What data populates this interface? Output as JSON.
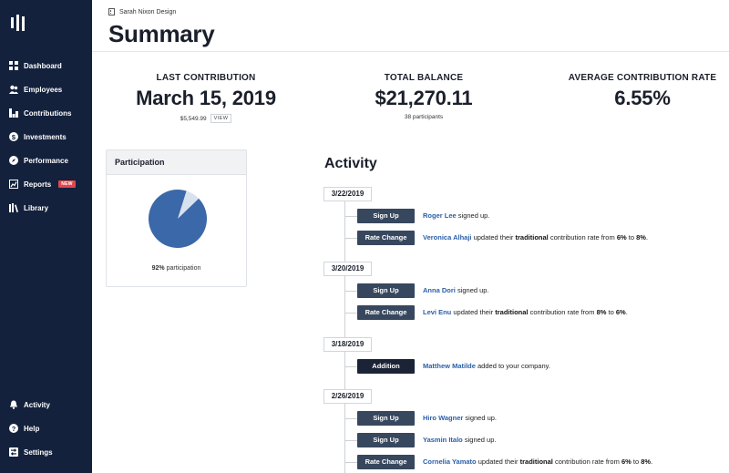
{
  "sidebar": {
    "items": [
      {
        "label": "Dashboard",
        "icon": "grid-icon"
      },
      {
        "label": "Employees",
        "icon": "users-icon"
      },
      {
        "label": "Contributions",
        "icon": "chart-icon"
      },
      {
        "label": "Investments",
        "icon": "dollar-icon"
      },
      {
        "label": "Performance",
        "icon": "compass-icon"
      },
      {
        "label": "Reports",
        "icon": "report-icon",
        "badge": "NEW"
      },
      {
        "label": "Library",
        "icon": "books-icon"
      }
    ],
    "bottom_items": [
      {
        "label": "Activity",
        "icon": "bell-icon"
      },
      {
        "label": "Help",
        "icon": "help-icon"
      },
      {
        "label": "Settings",
        "icon": "settings-icon"
      }
    ]
  },
  "header": {
    "company": "Sarah Nixon Design",
    "title": "Summary"
  },
  "stats": {
    "last_contribution": {
      "label": "LAST CONTRIBUTION",
      "value": "March 15, 2019",
      "sub": "$5,549.99",
      "action": "VIEW"
    },
    "total_balance": {
      "label": "TOTAL BALANCE",
      "value": "$21,270.11",
      "sub": "38 participants"
    },
    "average_rate": {
      "label": "AVERAGE CONTRIBUTION RATE",
      "value": "6.55%"
    }
  },
  "participation": {
    "title": "Participation",
    "percent": 92,
    "percent_label": "92%",
    "caption": "participation",
    "colors": {
      "filled": "#3b68a8",
      "rest": "#d8e2ee"
    }
  },
  "activity": {
    "title": "Activity",
    "groups": [
      {
        "date": "3/22/2019",
        "events": [
          {
            "type": "Sign Up",
            "person": "Roger Lee",
            "text": "signed up."
          },
          {
            "type": "Rate Change",
            "person": "Veronica Alhaji",
            "pre": "updated their",
            "kind": "traditional",
            "mid": "contribution rate from",
            "from": "6%",
            "to_word": "to",
            "to": "8%",
            "end": "."
          }
        ]
      },
      {
        "date": "3/20/2019",
        "events": [
          {
            "type": "Sign Up",
            "person": "Anna Dori",
            "text": "signed up."
          },
          {
            "type": "Rate Change",
            "person": "Levi Enu",
            "pre": "updated their",
            "kind": "traditional",
            "mid": "contribution rate from",
            "from": "8%",
            "to_word": "to",
            "to": "6%",
            "end": "."
          }
        ]
      },
      {
        "date": "3/18/2019",
        "events": [
          {
            "type": "Addition",
            "person": "Matthew Matilde",
            "text": "added to your company."
          }
        ]
      },
      {
        "date": "2/26/2019",
        "events": [
          {
            "type": "Sign Up",
            "person": "Hiro Wagner",
            "text": "signed up."
          },
          {
            "type": "Sign Up",
            "person": "Yasmin Italo",
            "text": "signed up."
          },
          {
            "type": "Rate Change",
            "person": "Cornelia Yamato",
            "pre": "updated their",
            "kind": "traditional",
            "mid": "contribution rate from",
            "from": "6%",
            "to_word": "to",
            "to": "8%",
            "end": "."
          }
        ]
      }
    ]
  }
}
